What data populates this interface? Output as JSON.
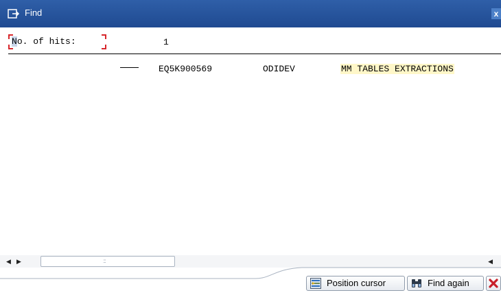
{
  "window": {
    "title": "Find",
    "close_glyph": "x"
  },
  "hits": {
    "label": "No. of hits:",
    "value": "1"
  },
  "results": [
    {
      "marker": "dash",
      "id": "EQ5K900569",
      "user": "ODIDEV",
      "description": "MM TABLES EXTRACTIONS"
    }
  ],
  "scrollbar": {
    "left_arrow": "◀",
    "right_arrow": "▶",
    "grip": ":::"
  },
  "buttons": {
    "position_cursor": {
      "label": "Position cursor",
      "icon": "position-cursor-icon"
    },
    "find_again": {
      "label": "Find again",
      "icon": "binoculars-icon"
    },
    "cancel": {
      "icon": "cancel-x-icon"
    }
  },
  "colors": {
    "titlebar": "#2a5aa3",
    "highlight": "#fff7c8",
    "frame_corner": "#d7262b",
    "cancel_red": "#c8202a"
  }
}
